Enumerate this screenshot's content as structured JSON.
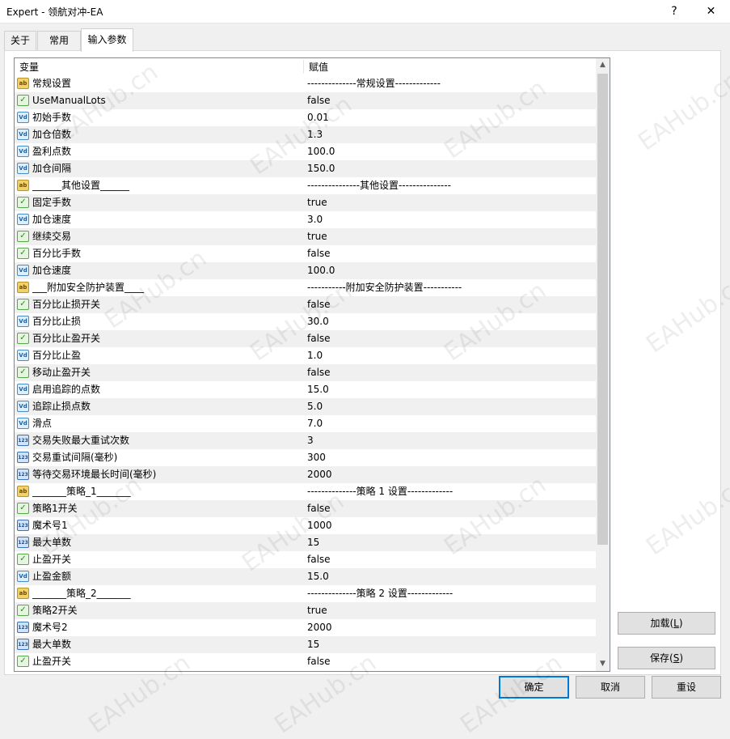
{
  "window": {
    "title": "Expert - 领航对冲-EA",
    "help_glyph": "?",
    "close_glyph": "✕"
  },
  "tabs": [
    {
      "label": "关于",
      "active": false
    },
    {
      "label": "常用",
      "active": false
    },
    {
      "label": "输入参数",
      "active": true
    }
  ],
  "grid": {
    "columns": {
      "variable": "变量",
      "value": "赋值"
    },
    "rows": [
      {
        "type": "ab",
        "icon": "string-icon",
        "name": "常规设置",
        "value": "--------------常规设置-------------"
      },
      {
        "type": "bool",
        "icon": "bool-icon",
        "name": "UseManualLots",
        "value": "false"
      },
      {
        "type": "dbl",
        "icon": "double-icon",
        "name": "初始手数",
        "value": "0.01"
      },
      {
        "type": "dbl",
        "icon": "double-icon",
        "name": "加仓倍数",
        "value": "1.3"
      },
      {
        "type": "dbl",
        "icon": "double-icon",
        "name": "盈利点数",
        "value": "100.0"
      },
      {
        "type": "dbl",
        "icon": "double-icon",
        "name": "加仓间隔",
        "value": "150.0"
      },
      {
        "type": "ab",
        "icon": "string-icon",
        "name": "______其他设置______",
        "value": "---------------其他设置---------------"
      },
      {
        "type": "bool",
        "icon": "bool-icon",
        "name": "固定手数",
        "value": "true"
      },
      {
        "type": "dbl",
        "icon": "double-icon",
        "name": "加仓速度",
        "value": "3.0"
      },
      {
        "type": "bool",
        "icon": "bool-icon",
        "name": "继续交易",
        "value": "true"
      },
      {
        "type": "bool",
        "icon": "bool-icon",
        "name": "百分比手数",
        "value": "false"
      },
      {
        "type": "dbl",
        "icon": "double-icon",
        "name": "加仓速度",
        "value": "100.0"
      },
      {
        "type": "ab",
        "icon": "string-icon",
        "name": "___附加安全防护装置____",
        "value": "-----------附加安全防护装置-----------"
      },
      {
        "type": "bool",
        "icon": "bool-icon",
        "name": "百分比止损开关",
        "value": "false"
      },
      {
        "type": "dbl",
        "icon": "double-icon",
        "name": "百分比止损",
        "value": "30.0"
      },
      {
        "type": "bool",
        "icon": "bool-icon",
        "name": "百分比止盈开关",
        "value": "false"
      },
      {
        "type": "dbl",
        "icon": "double-icon",
        "name": "百分比止盈",
        "value": "1.0"
      },
      {
        "type": "bool",
        "icon": "bool-icon",
        "name": "移动止盈开关",
        "value": "false"
      },
      {
        "type": "dbl",
        "icon": "double-icon",
        "name": "启用追踪的点数",
        "value": "15.0"
      },
      {
        "type": "dbl",
        "icon": "double-icon",
        "name": "追踪止损点数",
        "value": "5.0"
      },
      {
        "type": "dbl",
        "icon": "double-icon",
        "name": "滑点",
        "value": "7.0"
      },
      {
        "type": "int",
        "icon": "integer-icon",
        "name": "交易失败最大重试次数",
        "value": "3"
      },
      {
        "type": "int",
        "icon": "integer-icon",
        "name": "交易重试间隔(毫秒)",
        "value": "300"
      },
      {
        "type": "int",
        "icon": "integer-icon",
        "name": "等待交易环境最长时间(毫秒)",
        "value": "2000"
      },
      {
        "type": "ab",
        "icon": "string-icon",
        "name": "_______策略_1_______",
        "value": "--------------策略 1 设置-------------"
      },
      {
        "type": "bool",
        "icon": "bool-icon",
        "name": "策略1开关",
        "value": "false"
      },
      {
        "type": "int",
        "icon": "integer-icon",
        "name": "魔术号1",
        "value": "1000"
      },
      {
        "type": "int",
        "icon": "integer-icon",
        "name": "最大单数",
        "value": "15"
      },
      {
        "type": "bool",
        "icon": "bool-icon",
        "name": "止盈开关",
        "value": "false"
      },
      {
        "type": "dbl",
        "icon": "double-icon",
        "name": "止盈金额",
        "value": "15.0"
      },
      {
        "type": "ab",
        "icon": "string-icon",
        "name": "_______策略_2_______",
        "value": "--------------策略 2 设置-------------"
      },
      {
        "type": "bool",
        "icon": "bool-icon",
        "name": "策略2开关",
        "value": "true"
      },
      {
        "type": "int",
        "icon": "integer-icon",
        "name": "魔术号2",
        "value": "2000"
      },
      {
        "type": "int",
        "icon": "integer-icon",
        "name": "最大单数",
        "value": "15"
      },
      {
        "type": "bool",
        "icon": "bool-icon",
        "name": "止盈开关",
        "value": "false"
      }
    ]
  },
  "buttons": {
    "load": {
      "label": "加载(",
      "key": "L",
      "suffix": ")"
    },
    "save": {
      "label": "保存(",
      "key": "S",
      "suffix": ")"
    },
    "ok": "确定",
    "cancel": "取消",
    "reset": "重设"
  },
  "watermark": "EAHub.cn"
}
